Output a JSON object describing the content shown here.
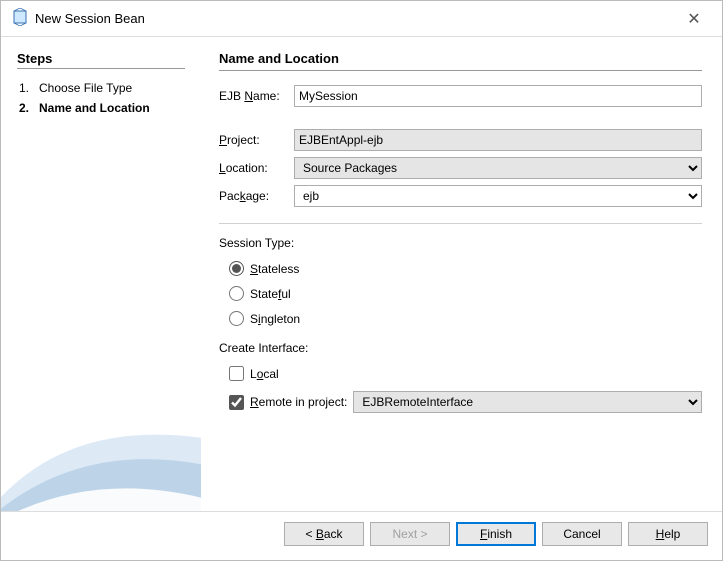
{
  "title": "New Session Bean",
  "sidebar": {
    "heading": "Steps",
    "items": [
      {
        "num": "1.",
        "label": "Choose File Type",
        "active": false
      },
      {
        "num": "2.",
        "label": "Name and Location",
        "active": true
      }
    ]
  },
  "content": {
    "heading": "Name and Location",
    "ejbName": {
      "label": "EJB Name:",
      "value": "MySession"
    },
    "project": {
      "label": "Project:",
      "value": "EJBEntAppl-ejb"
    },
    "location": {
      "label": "Location:",
      "value": "Source Packages"
    },
    "package": {
      "label": "Package:",
      "value": "ejb"
    },
    "sessionType": {
      "label": "Session Type:",
      "options": [
        {
          "label": "Stateless",
          "checked": true
        },
        {
          "label": "Stateful",
          "checked": false
        },
        {
          "label": "Singleton",
          "checked": false
        }
      ]
    },
    "createInterface": {
      "label": "Create Interface:",
      "local": {
        "label": "Local",
        "checked": false
      },
      "remote": {
        "label": "Remote in project:",
        "checked": true,
        "value": "EJBRemoteInterface"
      }
    }
  },
  "buttons": {
    "back": "< Back",
    "next": "Next >",
    "finish": "Finish",
    "cancel": "Cancel",
    "help": "Help"
  }
}
